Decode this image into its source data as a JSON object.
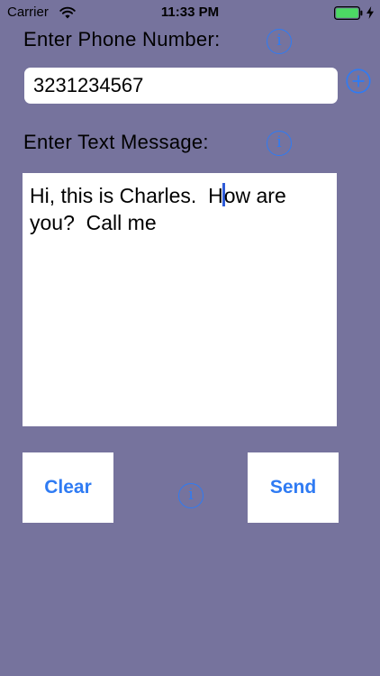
{
  "status_bar": {
    "carrier": "Carrier",
    "time": "11:33 PM",
    "battery_level": 1.0,
    "charging": true
  },
  "phone": {
    "label": "Enter Phone Number:",
    "value": "3231234567"
  },
  "message": {
    "label": "Enter Text Message:",
    "text_before_cursor": "Hi, this is Charles.  H",
    "text_after_cursor": "ow are you?  Call me"
  },
  "buttons": {
    "clear_label": "Clear",
    "send_label": "Send"
  },
  "icons": {
    "info_glyph": "i",
    "phone_info": "info-icon",
    "message_info": "info-icon",
    "bottom_info": "info-icon",
    "add_contact": "plus-circle-icon"
  },
  "colors": {
    "background": "#76739d",
    "accent": "#2f7bf3",
    "battery": "#4cd964",
    "cursor": "#2e5bd8"
  }
}
